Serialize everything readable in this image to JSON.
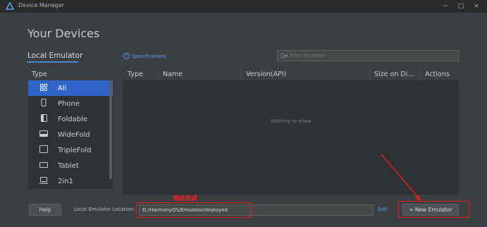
{
  "window": {
    "title": "Device Manager",
    "minimize": "−",
    "maximize": "□",
    "close": "×"
  },
  "heading": "Your Devices",
  "tab": "Local Emulator",
  "specifications": "Specifications",
  "search": {
    "placeholder": "Filter by name"
  },
  "type_list": {
    "header": "Type",
    "items": [
      {
        "label": "All",
        "icon": "grid-icon",
        "selected": true
      },
      {
        "label": "Phone",
        "icon": "phone-icon"
      },
      {
        "label": "Foldable",
        "icon": "foldable-icon"
      },
      {
        "label": "WideFold",
        "icon": "widefold-icon"
      },
      {
        "label": "TripleFold",
        "icon": "triplefold-icon"
      },
      {
        "label": "Tablet",
        "icon": "tablet-icon"
      },
      {
        "label": "2in1",
        "icon": "laptop-icon"
      }
    ]
  },
  "table": {
    "columns": [
      "Type",
      "Name",
      "Version(API)",
      "Size on Di...",
      "Actions"
    ],
    "empty_text": "Nothing to show"
  },
  "footer": {
    "help": "Help",
    "location_label": "Local Emulator Location:",
    "location_value": "D:/HarmonyOS/Emulator/deployed",
    "edit": "Edit",
    "new_emulator": "+ New Emulator"
  },
  "annotation": {
    "text": "修改完成",
    "color": "#ff2020"
  }
}
